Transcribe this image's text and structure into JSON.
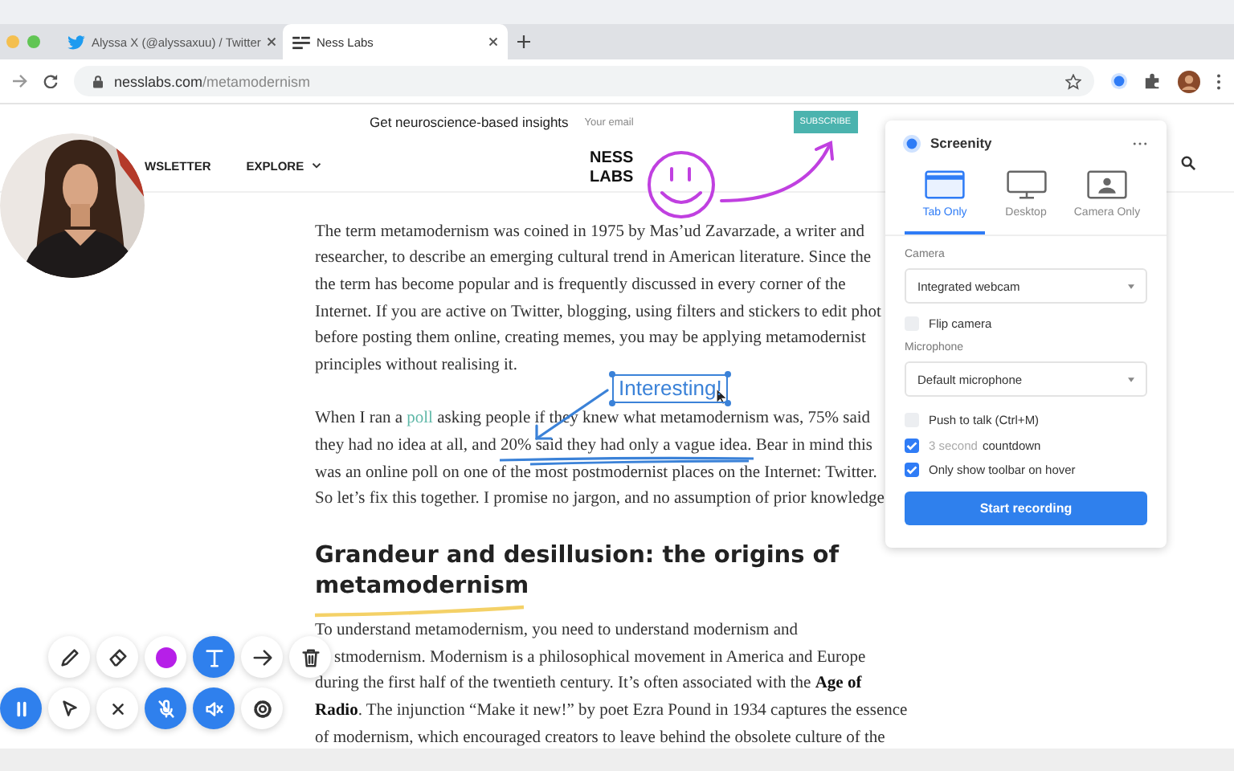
{
  "browser": {
    "tabs": [
      {
        "title": "Alyssa X (@alyssaxuu) / Twitter",
        "kind": "twitter",
        "selected": false
      },
      {
        "title": "Ness Labs",
        "kind": "site",
        "selected": true
      }
    ],
    "url_host": "nesslabs.com",
    "url_path": "/metamodernism"
  },
  "banner": {
    "text": "Get neuroscience-based insights",
    "email_placeholder": "Your email",
    "button": "SUBSCRIBE"
  },
  "nav": {
    "items": [
      "WSLETTER",
      "EXPLORE"
    ],
    "logo": [
      "NESS",
      "LABS"
    ]
  },
  "article": {
    "paragraphs": [
      {
        "lines": [
          [
            {
              "kind": "plain",
              "text": "The term metamodernism was coined in 1975 by Mas’ud Zavarzade, a writer and"
            }
          ],
          [
            {
              "kind": "plain",
              "text": "researcher, to describe an emerging cultural trend in American literature. Since the"
            }
          ],
          [
            {
              "kind": "plain",
              "text": "the term has become popular and is frequently discussed in every corner of the"
            }
          ],
          [
            {
              "kind": "plain",
              "text": "Internet. If you are active on Twitter, blogging, using filters and stickers to edit phot"
            }
          ],
          [
            {
              "kind": "plain",
              "text": "before posting them online, creating memes, you may be applying metamodernist"
            }
          ],
          [
            {
              "kind": "plain",
              "text": "principles without realising it."
            }
          ]
        ]
      },
      {
        "lines": [
          [
            {
              "kind": "plain",
              "text": "When I ran a "
            },
            {
              "kind": "link",
              "text": "poll"
            },
            {
              "kind": "plain",
              "text": " asking people if they knew what metamodernism was, 75% said"
            }
          ],
          [
            {
              "kind": "plain",
              "text": "they had no idea at all, and 20% said they had only a vague idea. Bear in mind this"
            }
          ],
          [
            {
              "kind": "plain",
              "text": "was an online poll on one of the most postmodernist places on the Internet: Twitter."
            }
          ],
          [
            {
              "kind": "plain",
              "text": "So let’s fix this together. I promise no jargon, and no assumption of prior knowledge"
            }
          ]
        ]
      },
      {
        "heading": [
          "Grandeur and desillusion: the origins of",
          "metamodernism"
        ]
      },
      {
        "lines": [
          [
            {
              "kind": "plain",
              "text": "To understand metamodernism, you need to understand modernism and"
            }
          ],
          [
            {
              "kind": "plain",
              "text": "stmodernism. Modernism is a philosophical movement in America and Europe"
            }
          ],
          [
            {
              "kind": "plain",
              "text": "during the first half of the twentieth century. It’s often associated with the **Age of**"
            }
          ],
          [
            {
              "kind": "plain",
              "text": "**Radio**. The injunction “Make it new!” by poet Ezra Pound in 1934 captures the essence"
            }
          ],
          [
            {
              "kind": "plain",
              "text": "of modernism, which encouraged creators to leave behind the obsolete culture of the"
            }
          ]
        ]
      }
    ]
  },
  "annotation": {
    "text_box": "Interesting!"
  },
  "popup": {
    "title": "Screenity",
    "tabs": [
      {
        "label": "Tab Only",
        "kind": "tab",
        "selected": true
      },
      {
        "label": "Desktop",
        "kind": "desktop",
        "selected": false
      },
      {
        "label": "Camera Only",
        "kind": "camera",
        "selected": false
      }
    ],
    "camera_label": "Camera",
    "camera_select": "Integrated webcam",
    "flip_camera": {
      "label": "Flip camera",
      "checked": false
    },
    "microphone_label": "Microphone",
    "microphone_select": "Default microphone",
    "options": [
      {
        "label": "Push to talk (Ctrl+M)",
        "checked": false
      },
      {
        "value": "3 second",
        "label": "countdown",
        "checked": true
      },
      {
        "label": "Only show toolbar on hover",
        "checked": true
      }
    ],
    "button": "Start recording"
  },
  "toolbar_rows": [
    {
      "buttons": [
        {
          "kind": "pencil",
          "active": false
        },
        {
          "kind": "eraser",
          "active": false
        },
        {
          "kind": "color",
          "active": false,
          "color": "#b61fe8"
        },
        {
          "kind": "text",
          "active": true
        },
        {
          "kind": "arrow",
          "active": false
        },
        {
          "kind": "trash",
          "active": false
        }
      ]
    },
    {
      "buttons": [
        {
          "kind": "pause",
          "active": true
        },
        {
          "kind": "pointer",
          "active": false
        },
        {
          "kind": "close",
          "active": false
        },
        {
          "kind": "mic-off",
          "active": true
        },
        {
          "kind": "sound-off",
          "active": true
        },
        {
          "kind": "settings",
          "active": false
        }
      ]
    }
  ]
}
